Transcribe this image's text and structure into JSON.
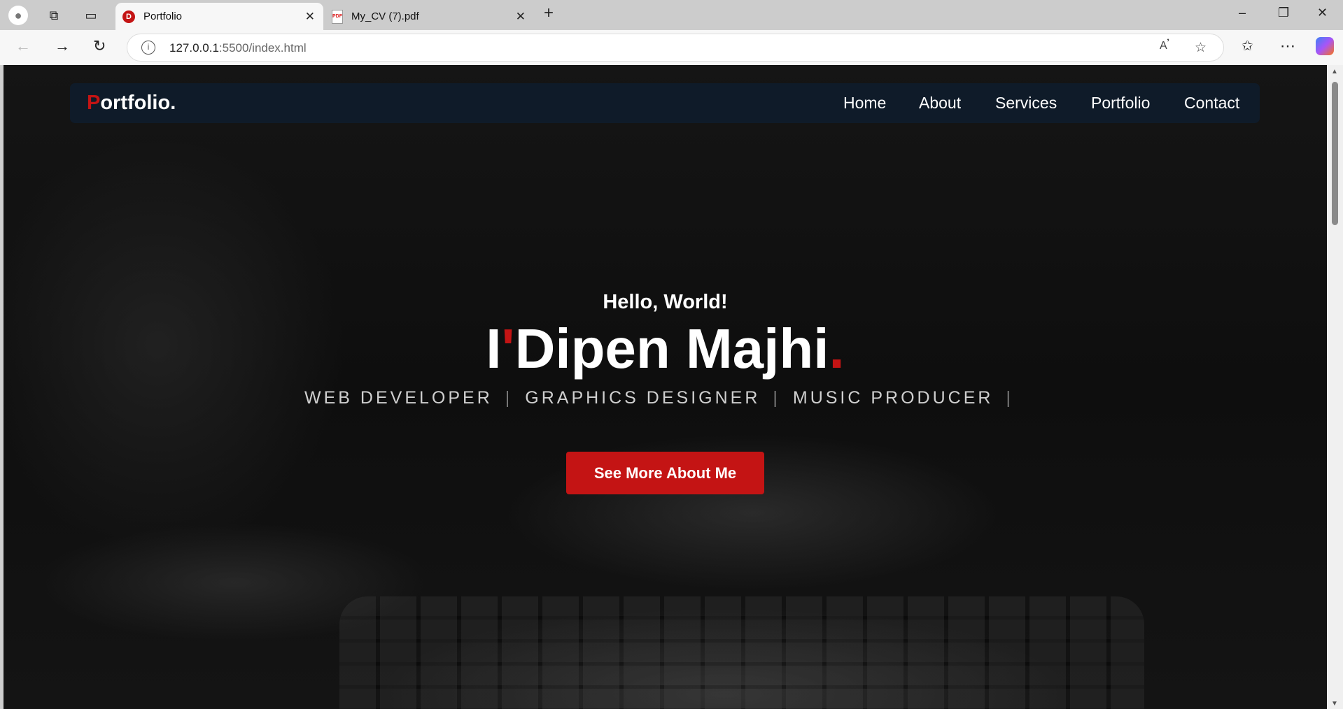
{
  "browser": {
    "tabs": [
      {
        "title": "Portfolio",
        "favicon": "D",
        "active": true
      },
      {
        "title": "My_CV (7).pdf",
        "favicon": "PDF",
        "active": false
      }
    ],
    "url_host": "127.0.0.1",
    "url_rest": ":5500/index.html"
  },
  "navbar": {
    "logo_first": "P",
    "logo_rest": "ortfolio.",
    "links": [
      "Home",
      "About",
      "Services",
      "Portfolio",
      "Contact"
    ]
  },
  "hero": {
    "greeting": "Hello, World!",
    "name_prefix": "I",
    "name_apostrophe": "'",
    "name": "Dipen Majhi",
    "name_dot": ".",
    "roles": [
      "WEB DEVELOPER",
      "GRAPHICS DESIGNER",
      "MUSIC PRODUCER"
    ],
    "separator": "|",
    "cta": "See More About Me"
  },
  "colors": {
    "accent": "#c41414",
    "navbar": "#0f1b29"
  }
}
